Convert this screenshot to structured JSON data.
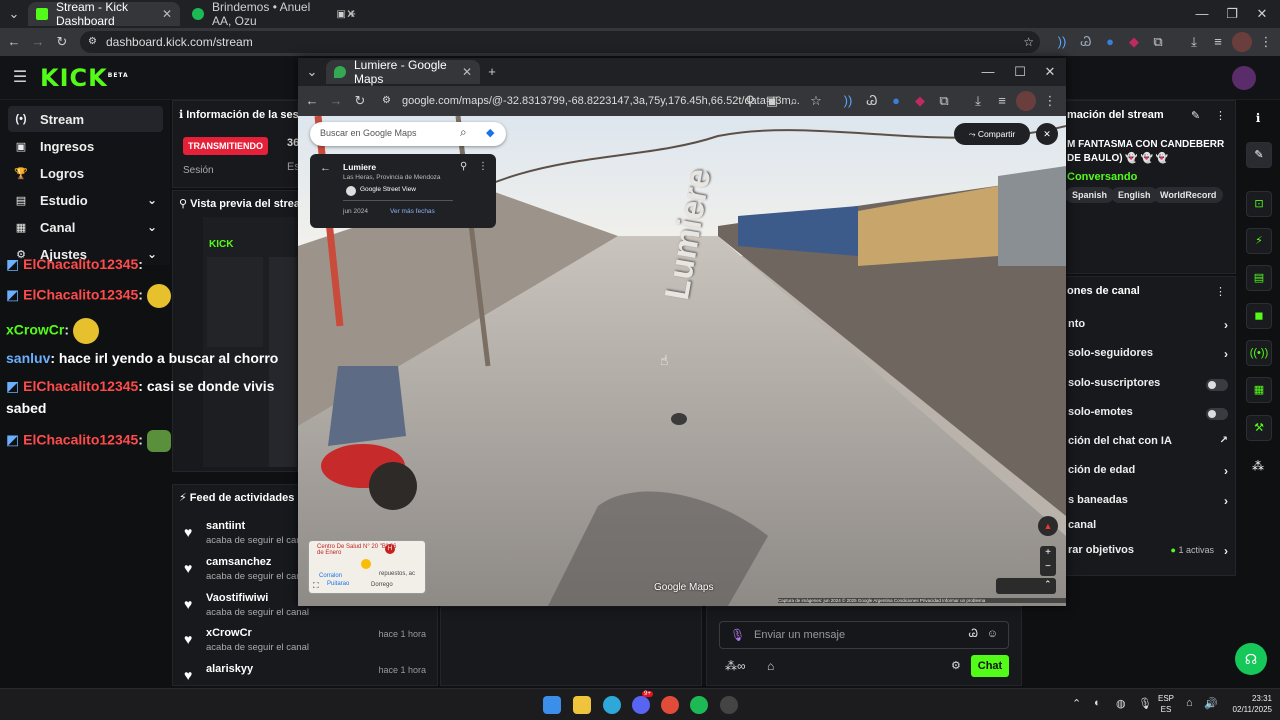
{
  "browser": {
    "tabs": [
      {
        "label": "Stream - Kick Dashboard",
        "close": "✕"
      },
      {
        "label": "Brindemos • Anuel AA, Ozu",
        "close": "✕"
      }
    ],
    "new_tab": "+",
    "url": "dashboard.kick.com/stream"
  },
  "kick": {
    "logo": "KICK",
    "logo_beta": "BETA",
    "sidebar": [
      {
        "label": "Stream",
        "icon": "(•)"
      },
      {
        "label": "Ingresos",
        "icon": "▣"
      },
      {
        "label": "Logros",
        "icon": "🏆"
      },
      {
        "label": "Estudio",
        "icon": "▤",
        "chevron": "⌄"
      },
      {
        "label": "Canal",
        "icon": "▦",
        "chevron": "⌄"
      },
      {
        "label": "Ajustes",
        "icon": "⚙",
        "chevron": "⌄"
      }
    ],
    "session_panel": {
      "title": "Información de la sesi",
      "status": "TRANSMITIENDO",
      "session_label": "Sesión",
      "value_fragment": "36",
      "value_fragment2": "Es"
    },
    "preview_title": "Vista previa del stream",
    "chat_lines": [
      {
        "user": "ElChacalito12345",
        "text": ":"
      },
      {
        "user": "xCrowCr",
        "text": ":"
      },
      {
        "user": "sanluv",
        "text": ": hace irl yendo a buscar al chorro"
      },
      {
        "user": "ElChacalito12345",
        "text": ": casi se donde vivis"
      },
      {
        "user": "",
        "text": "sabed"
      },
      {
        "user": "ElChacalito12345",
        "text": ":"
      }
    ],
    "feed": {
      "title": "Feed de actividades",
      "items": [
        {
          "name": "santiint",
          "sub": "acaba de seguir el canal",
          "time": ""
        },
        {
          "name": "camsanchez",
          "sub": "acaba de seguir el canal",
          "time": ""
        },
        {
          "name": "Vaostifiwiwi",
          "sub": "acaba de seguir el canal",
          "time": ""
        },
        {
          "name": "xCrowCr",
          "sub": "acaba de seguir el canal",
          "time": "hace 1 hora"
        },
        {
          "name": "alariskyy",
          "sub": "",
          "time": "hace 1 hora"
        }
      ]
    },
    "stream_info": {
      "title": "mación del stream",
      "stream_title_l1": "M FANTASMA CON CANDEBERR",
      "stream_title_l2": "DE BAULO) 👻 👻 👻",
      "category": "Conversando",
      "tags": [
        "Spanish",
        "English",
        "WorldRecord"
      ]
    },
    "channel_options": {
      "title": "ones de canal",
      "rows": [
        {
          "label": "nto",
          "control": "arrow"
        },
        {
          "label": "solo-seguidores",
          "control": "arrow"
        },
        {
          "label": "solo-suscriptores",
          "control": "toggle"
        },
        {
          "label": "solo-emotes",
          "control": "toggle"
        },
        {
          "label": "ción del chat con IA",
          "control": "external"
        },
        {
          "label": "ción de edad",
          "control": "arrow"
        },
        {
          "label": "s baneadas",
          "control": "arrow"
        },
        {
          "label": "canal",
          "control": "none"
        },
        {
          "label": "rar objetivos",
          "control": "arrow",
          "badge": "1 activas"
        }
      ]
    },
    "chat_input": {
      "placeholder": "Enviar un mensaje",
      "send": "Chat"
    }
  },
  "maps_window": {
    "tab_title": "Lumiere - Google Maps",
    "url": "google.com/maps/@-32.8313799,-68.8223147,3a,75y,176.45h,66.52t/data=!3m...",
    "search_placeholder": "Buscar en Google Maps",
    "share": "Compartir",
    "place": {
      "name": "Lumiere",
      "region": "Las Heras, Provincia de Mendoza",
      "source": "Google Street View",
      "date": "jun 2024",
      "more_dates": "Ver más fechas"
    },
    "street_label": "Lumiere",
    "minimap_labels": [
      "Centro De Salud N° 20 \"B\" 26 de Enero",
      "repuestos, ac",
      "Corralon",
      "Puitarao",
      "Dorrego"
    ],
    "watermark": "Google Maps",
    "footer": "Captura de imágenes: jun 2024   © 2025 Google   Argentina   Condiciones   Privacidad   Informar un problema"
  },
  "taskbar": {
    "lang": "ESP",
    "lang2": "ES",
    "time": "23:31",
    "date": "02/11/2025",
    "discord_badge": "9+"
  },
  "colors": {
    "kick_green": "#53fc18",
    "live_red": "#e5213a",
    "chat_red": "#ff4b4b",
    "chat_green": "#53fc18",
    "chat_blue": "#6ab0ff"
  }
}
